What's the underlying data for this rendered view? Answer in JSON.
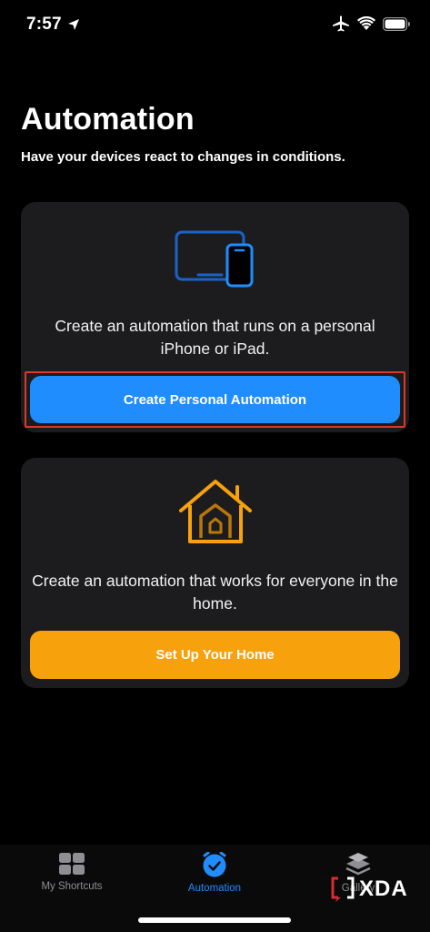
{
  "status_bar": {
    "time": "7:57"
  },
  "header": {
    "title": "Automation",
    "subtitle": "Have your devices react to changes in conditions."
  },
  "personal_card": {
    "description": "Create an automation that runs on a personal iPhone or iPad.",
    "button_label": "Create Personal Automation",
    "icon": "devices-icon",
    "accent_color": "#1f8dfd"
  },
  "home_card": {
    "description": "Create an automation that works for everyone in the home.",
    "button_label": "Set Up Your Home",
    "icon": "home-icon",
    "accent_color": "#f7a10c"
  },
  "tab_bar": {
    "tabs": [
      {
        "label": "My Shortcuts",
        "icon": "grid-icon",
        "active": false
      },
      {
        "label": "Automation",
        "icon": "clock-check-icon",
        "active": true
      },
      {
        "label": "Gallery",
        "icon": "layers-icon",
        "active": false
      }
    ]
  },
  "watermark": {
    "text": "XDA"
  }
}
